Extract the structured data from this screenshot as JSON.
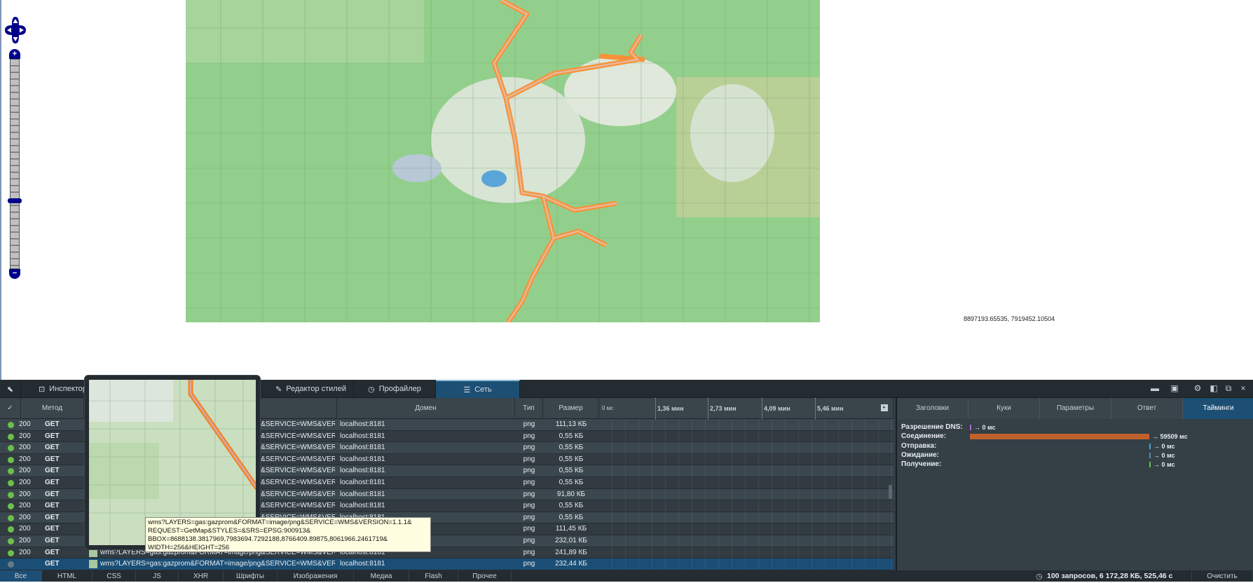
{
  "map": {
    "coordinates": "8897193.65535, 7919452.10504",
    "route_color": "#f7923a",
    "zoom_level_fraction": 0.3
  },
  "toolbar": {
    "tabs": [
      {
        "label": "Инспектор",
        "icon": "inspector-icon"
      },
      {
        "label": "Редактор стилей",
        "icon": "style-editor-icon"
      },
      {
        "label": "Профайлер",
        "icon": "profiler-icon"
      },
      {
        "label": "Сеть",
        "icon": "network-icon",
        "active": true
      }
    ]
  },
  "columns": {
    "check": "✓",
    "method": "Метод",
    "domain": "Домен",
    "type": "Тип",
    "size": "Размер",
    "timeline": [
      "0 мс",
      "1,36 мин",
      "2,73 мин",
      "4,09 мин",
      "5,46 мин"
    ]
  },
  "rows": [
    {
      "status": "200",
      "method": "GET",
      "url": "wms?LAYERS=gas:gazprom&FORMAT=image/png&SERVICE=WMS&VER...",
      "domain": "localhost:8181",
      "type": "png",
      "size": "111,13 КБ"
    },
    {
      "status": "200",
      "method": "GET",
      "url": "wms?LAYERS=gas:gazprom&FORMAT=image/png&SERVICE=WMS&VER...",
      "domain": "localhost:8181",
      "type": "png",
      "size": "0,55 КБ"
    },
    {
      "status": "200",
      "method": "GET",
      "url": "wms?LAYERS=gas:gazprom&FORMAT=image/png&SERVICE=WMS&VER...",
      "domain": "localhost:8181",
      "type": "png",
      "size": "0,55 КБ"
    },
    {
      "status": "200",
      "method": "GET",
      "url": "wms?LAYERS=gas:gazprom&FORMAT=image/png&SERVICE=WMS&VER...",
      "domain": "localhost:8181",
      "type": "png",
      "size": "0,55 КБ"
    },
    {
      "status": "200",
      "method": "GET",
      "url": "wms?LAYERS=gas:gazprom&FORMAT=image/png&SERVICE=WMS&VER...",
      "domain": "localhost:8181",
      "type": "png",
      "size": "0,55 КБ"
    },
    {
      "status": "200",
      "method": "GET",
      "url": "wms?LAYERS=gas:gazprom&FORMAT=image/png&SERVICE=WMS&VER...",
      "domain": "localhost:8181",
      "type": "png",
      "size": "0,55 КБ"
    },
    {
      "status": "200",
      "method": "GET",
      "url": "wms?LAYERS=gas:gazprom&FORMAT=image/png&SERVICE=WMS&VER...",
      "domain": "localhost:8181",
      "type": "png",
      "size": "91,80 КБ"
    },
    {
      "status": "200",
      "method": "GET",
      "url": "wms?LAYERS=gas:gazprom&FORMAT=image/png&SERVICE=WMS&VER...",
      "domain": "localhost:8181",
      "type": "png",
      "size": "0,55 КБ"
    },
    {
      "status": "200",
      "method": "GET",
      "url": "wms?LAYERS=gas:gazprom&FORMAT=image/png&SERVICE=WMS&VER...",
      "domain": "localhost:8181",
      "type": "png",
      "size": "0,55 КБ"
    },
    {
      "status": "200",
      "method": "GET",
      "url": "wms?LAYERS=gas:gazprom&FORMAT=image/png&SERVICE=WMS&VER...",
      "domain": "localhost:8181",
      "type": "png",
      "size": "111,45 КБ"
    },
    {
      "status": "200",
      "method": "GET",
      "url": "wms?LAYERS=gas:gazprom&FORMAT=image/png&SERVICE=WMS&VER...",
      "domain": "localhost:8181",
      "type": "png",
      "size": "232,01 КБ"
    },
    {
      "status": "200",
      "method": "GET",
      "url": "wms?LAYERS=gas:gazprom&FORMAT=image/png&SERVICE=WMS&VER...",
      "domain": "localhost:8181",
      "type": "png",
      "size": "241,89 КБ"
    },
    {
      "status": "",
      "method": "GET",
      "url": "wms?LAYERS=gas:gazprom&FORMAT=image/png&SERVICE=WMS&VER...",
      "domain": "localhost:8181",
      "type": "png",
      "size": "232,44 КБ",
      "selected": true
    }
  ],
  "tooltip": {
    "lines": [
      "wms?LAYERS=gas:gazprom&FORMAT=image/png&SERVICE=WMS&VERSION=1.1.1&",
      "REQUEST=GetMap&STYLES=&SRS=EPSG:900913&",
      "BBOX=8688138.3817969,7983694.7292188,8766409.89875,8061966.2461719&",
      "WIDTH=256&HEIGHT=256"
    ]
  },
  "details": {
    "tabs": [
      "Заголовки",
      "Куки",
      "Параметры",
      "Ответ",
      "Тайминги"
    ],
    "active_tab": "Тайминги",
    "timings": [
      {
        "label": "Разрешение DNS:",
        "value": "→ 0 мс",
        "ms": 0,
        "color": "#a86bd0"
      },
      {
        "label": "Соединение:",
        "value": "→ 59509 мс",
        "ms": 59509,
        "color": "#c0602a"
      },
      {
        "label": "Отправка:",
        "value": "→ 0 мс",
        "ms": 0,
        "color": "#4aa6d8"
      },
      {
        "label": "Ожидание:",
        "value": "→ 0 мс",
        "ms": 0,
        "color": "#5f86b0"
      },
      {
        "label": "Получение:",
        "value": "→ 0 мс",
        "ms": 0,
        "color": "#6cc04a"
      }
    ]
  },
  "filters": [
    "Все",
    "HTML",
    "CSS",
    "JS",
    "XHR",
    "Шрифты",
    "Изображения",
    "Медиа",
    "Flash",
    "Прочее"
  ],
  "status": {
    "summary": "100 запросов, 6 172,28 КБ, 525,46 с",
    "clear": "Очистить"
  }
}
